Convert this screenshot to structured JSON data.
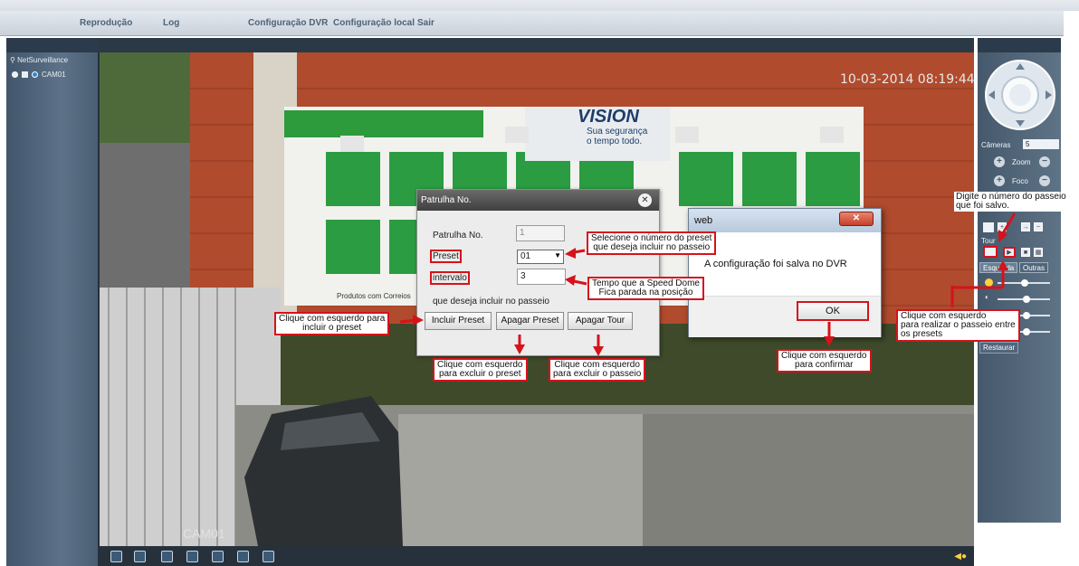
{
  "menu": {
    "items": [
      "Reprodução",
      "Log",
      "Configuração DVR",
      "Configuração local",
      "Sair"
    ]
  },
  "left_panel": {
    "root": "NetSurveillance",
    "camera": "CAM01"
  },
  "video": {
    "timestamp": "10-03-2014 08:19:44",
    "camera_label": "CAM01",
    "sign_brand": "VISION",
    "sign_tagline_1": "Sua segurança",
    "sign_tagline_2": "o tempo todo.",
    "sign_footer": "Produtos com Correios"
  },
  "right_panel": {
    "cameras_label": "Câmeras",
    "cameras_value": "5",
    "zoom_label": "Zoom",
    "foco_label": "Foco",
    "tour_label": "Tour",
    "tab_esquerda": "Esquerda",
    "tab_outras": "Outras",
    "restaurar": "Restaurar"
  },
  "patrulha_dialog": {
    "title": "Patrulha No.",
    "patrulha_label": "Patrulha No.",
    "patrulha_value": "1",
    "preset_label": "Preset",
    "preset_value": "01",
    "intervalo_label": "intervalo",
    "intervalo_value": "3",
    "incluir_text": "que deseja incluir no passeio",
    "btn_incluir": "Incluir Preset",
    "btn_apagar_preset": "Apagar Preset",
    "btn_apagar_tour": "Apagar Tour"
  },
  "web_dialog": {
    "title": "web",
    "message": "A configuração foi salva no DVR",
    "ok": "OK"
  },
  "annotations": {
    "preset_1": "Selecione o número do preset",
    "preset_2": "que deseja incluir no passeio",
    "intervalo_1": "Tempo que a Speed Dome",
    "intervalo_2": "Fica parada na posição",
    "incluir_1": "Clique com esquerdo para",
    "incluir_2": "incluir o preset",
    "apagar_preset_1": "Clique com esquerdo",
    "apagar_preset_2": "para excluir o preset",
    "apagar_tour_1": "Clique com esquerdo",
    "apagar_tour_2": "para excluir o passeio",
    "ok_1": "Clique com esquerdo",
    "ok_2": "para confirmar",
    "digite_1": "Digite o número do passeio",
    "digite_2": "que foi salvo.",
    "realizar_1": "Clique com esquerdo",
    "realizar_2": "para realizar o passeio entre",
    "realizar_3": "os presets"
  },
  "colors": {
    "annotation_red": "#d6121b",
    "panel_blue": "#4a5e73",
    "menu_text": "#4e6277"
  }
}
